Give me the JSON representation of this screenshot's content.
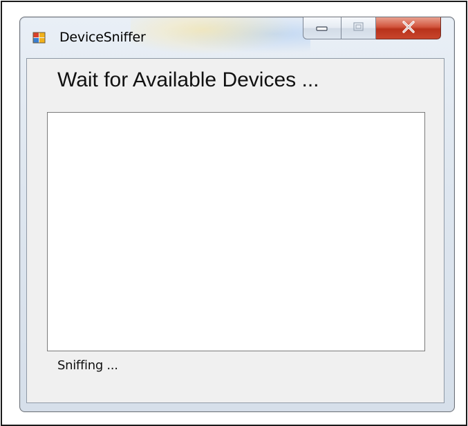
{
  "window": {
    "title": "DeviceSniffer",
    "icon": "windows-app-icon"
  },
  "caption_buttons": {
    "minimize_icon": "minimize-icon",
    "maximize_icon": "maximize-icon",
    "close_icon": "close-icon",
    "close_glyph": "X",
    "close_color": "#c8452c"
  },
  "main": {
    "heading": "Wait for Available Devices ...",
    "device_list": [],
    "status": "Sniffing ..."
  }
}
